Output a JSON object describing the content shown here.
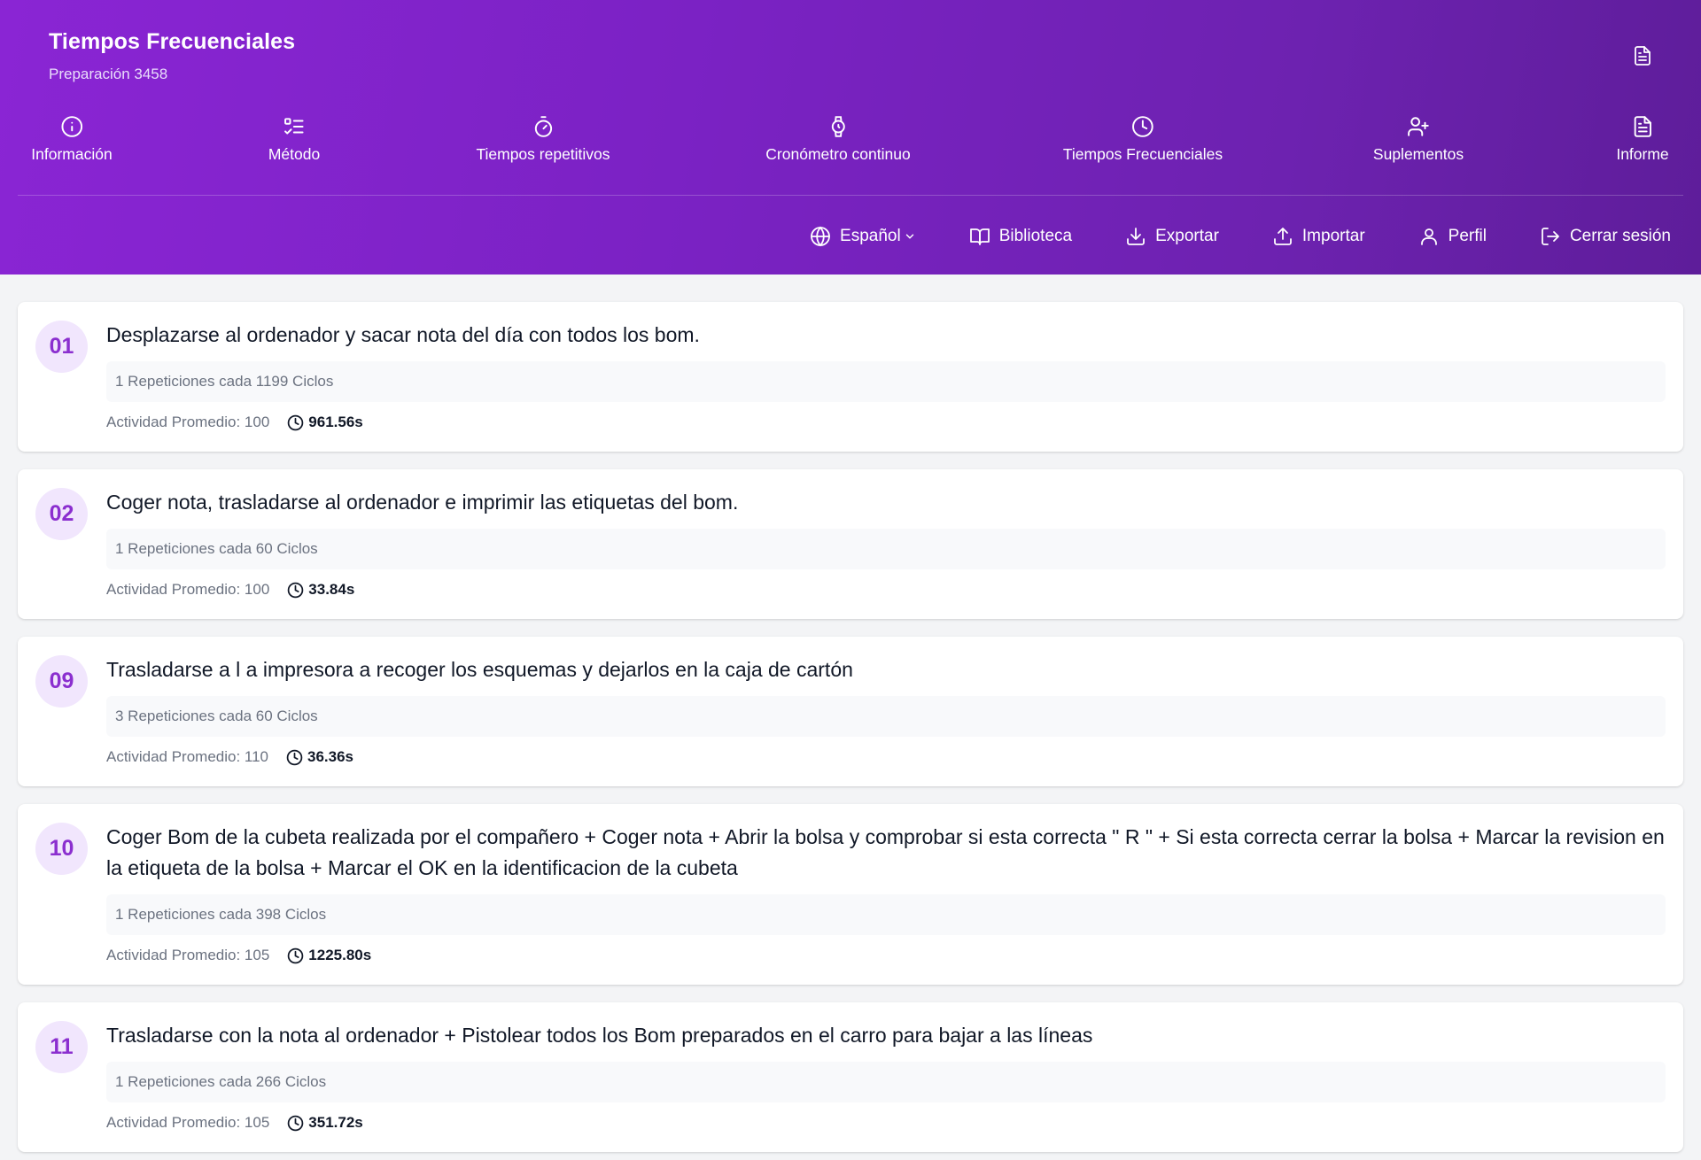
{
  "header": {
    "title": "Tiempos Frecuenciales",
    "subtitle": "Preparación 3458",
    "report_icon": "file-text-icon"
  },
  "nav": [
    {
      "label": "Información",
      "icon": "info-icon"
    },
    {
      "label": "Método",
      "icon": "list-checks-icon"
    },
    {
      "label": "Tiempos repetitivos",
      "icon": "timer-icon"
    },
    {
      "label": "Cronómetro continuo",
      "icon": "watch-icon"
    },
    {
      "label": "Tiempos Frecuenciales",
      "icon": "clock-icon"
    },
    {
      "label": "Suplementos",
      "icon": "user-plus-icon"
    },
    {
      "label": "Informe",
      "icon": "file-text-icon"
    }
  ],
  "actions": {
    "language": "Español",
    "library": "Biblioteca",
    "export": "Exportar",
    "import": "Importar",
    "profile": "Perfil",
    "logout": "Cerrar sesión"
  },
  "items": [
    {
      "num": "01",
      "title": "Desplazarse al ordenador y sacar nota del día con todos los bom.",
      "reps": "1 Repeticiones cada 1199 Ciclos",
      "activity": "Actividad Promedio: 100",
      "time": "961.56s"
    },
    {
      "num": "02",
      "title": "Coger nota, trasladarse al ordenador e imprimir las etiquetas del bom.",
      "reps": "1 Repeticiones cada 60 Ciclos",
      "activity": "Actividad Promedio: 100",
      "time": "33.84s"
    },
    {
      "num": "09",
      "title": "Trasladarse a l a impresora a recoger los esquemas y dejarlos en la caja de cartón",
      "reps": "3 Repeticiones cada 60 Ciclos",
      "activity": "Actividad Promedio: 110",
      "time": "36.36s"
    },
    {
      "num": "10",
      "title": "Coger Bom de la cubeta realizada por el compañero + Coger nota + Abrir la bolsa y comprobar si esta correcta \" R \" + Si esta correcta cerrar la bolsa + Marcar la revision en la etiqueta de la bolsa + Marcar el OK en la identificacion de la cubeta",
      "reps": "1 Repeticiones cada 398 Ciclos",
      "activity": "Actividad Promedio: 105",
      "time": "1225.80s"
    },
    {
      "num": "11",
      "title": "Trasladarse con la nota al ordenador + Pistolear todos los Bom preparados en el carro para bajar a las líneas",
      "reps": "1 Repeticiones cada 266 Ciclos",
      "activity": "Actividad Promedio: 105",
      "time": "351.72s"
    }
  ]
}
